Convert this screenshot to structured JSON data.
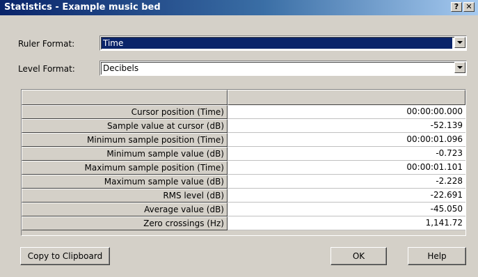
{
  "window": {
    "title": "Statistics - Example music bed",
    "help_button": "?",
    "close_button": "✕"
  },
  "ruler_format": {
    "label": "Ruler Format:",
    "value": "Time"
  },
  "level_format": {
    "label": "Level Format:",
    "value": "Decibels"
  },
  "table": {
    "headers": [
      "",
      ""
    ],
    "rows": [
      {
        "name": "Cursor position (Time)",
        "value": "00:00:00.000"
      },
      {
        "name": "Sample value at cursor (dB)",
        "value": "-52.139"
      },
      {
        "name": "Minimum sample position (Time)",
        "value": "00:00:01.096"
      },
      {
        "name": "Minimum sample value (dB)",
        "value": "-0.723"
      },
      {
        "name": "Maximum sample position (Time)",
        "value": "00:00:01.101"
      },
      {
        "name": "Maximum sample value (dB)",
        "value": "-2.228"
      },
      {
        "name": "RMS level (dB)",
        "value": "-22.691"
      },
      {
        "name": "Average value (dB)",
        "value": "-45.050"
      },
      {
        "name": "Zero crossings (Hz)",
        "value": "1,141.72"
      }
    ]
  },
  "buttons": {
    "copy": "Copy to Clipboard",
    "ok": "OK",
    "help": "Help"
  },
  "colors": {
    "titlebar_start": "#0a246a",
    "titlebar_end": "#a6caf0",
    "face": "#d4d0c8",
    "selection": "#0a246a"
  }
}
